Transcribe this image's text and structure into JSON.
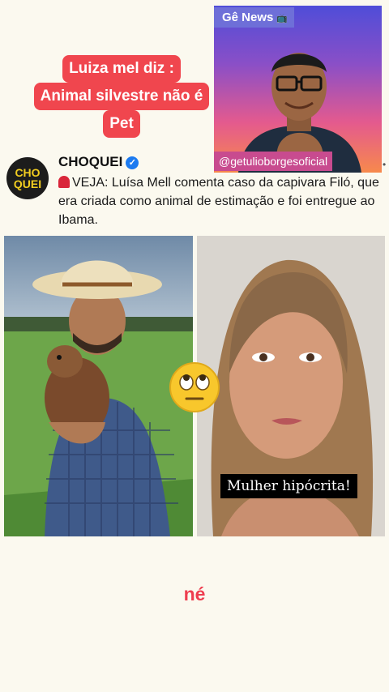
{
  "headline": {
    "line1": "Luiza mel  diz :",
    "line2": "Animal silvestre não é",
    "line3": "Pet"
  },
  "video_overlay": {
    "channel_badge": "Gê News",
    "handle": "@getulioborgesoficial"
  },
  "post": {
    "avatar_text_top": "CHO",
    "avatar_text_bottom": "QUEI",
    "author": "CHOQUEI",
    "text": "VEJA: Luísa Mell comenta caso da capivara Filó, que era criada como animal de estimação e foi entregue ao Ibama."
  },
  "caption": "Mulher hipócrita!",
  "subtitle": "né",
  "colors": {
    "headline_bg": "#f0464e",
    "subtitle": "#ee3d4f",
    "badge_bg": "#6e6fd8",
    "handle_bg": "#c84b8f"
  },
  "icons": [
    "tv-icon",
    "verified-badge-icon",
    "siren-icon",
    "eye-roll-emoji-icon"
  ]
}
